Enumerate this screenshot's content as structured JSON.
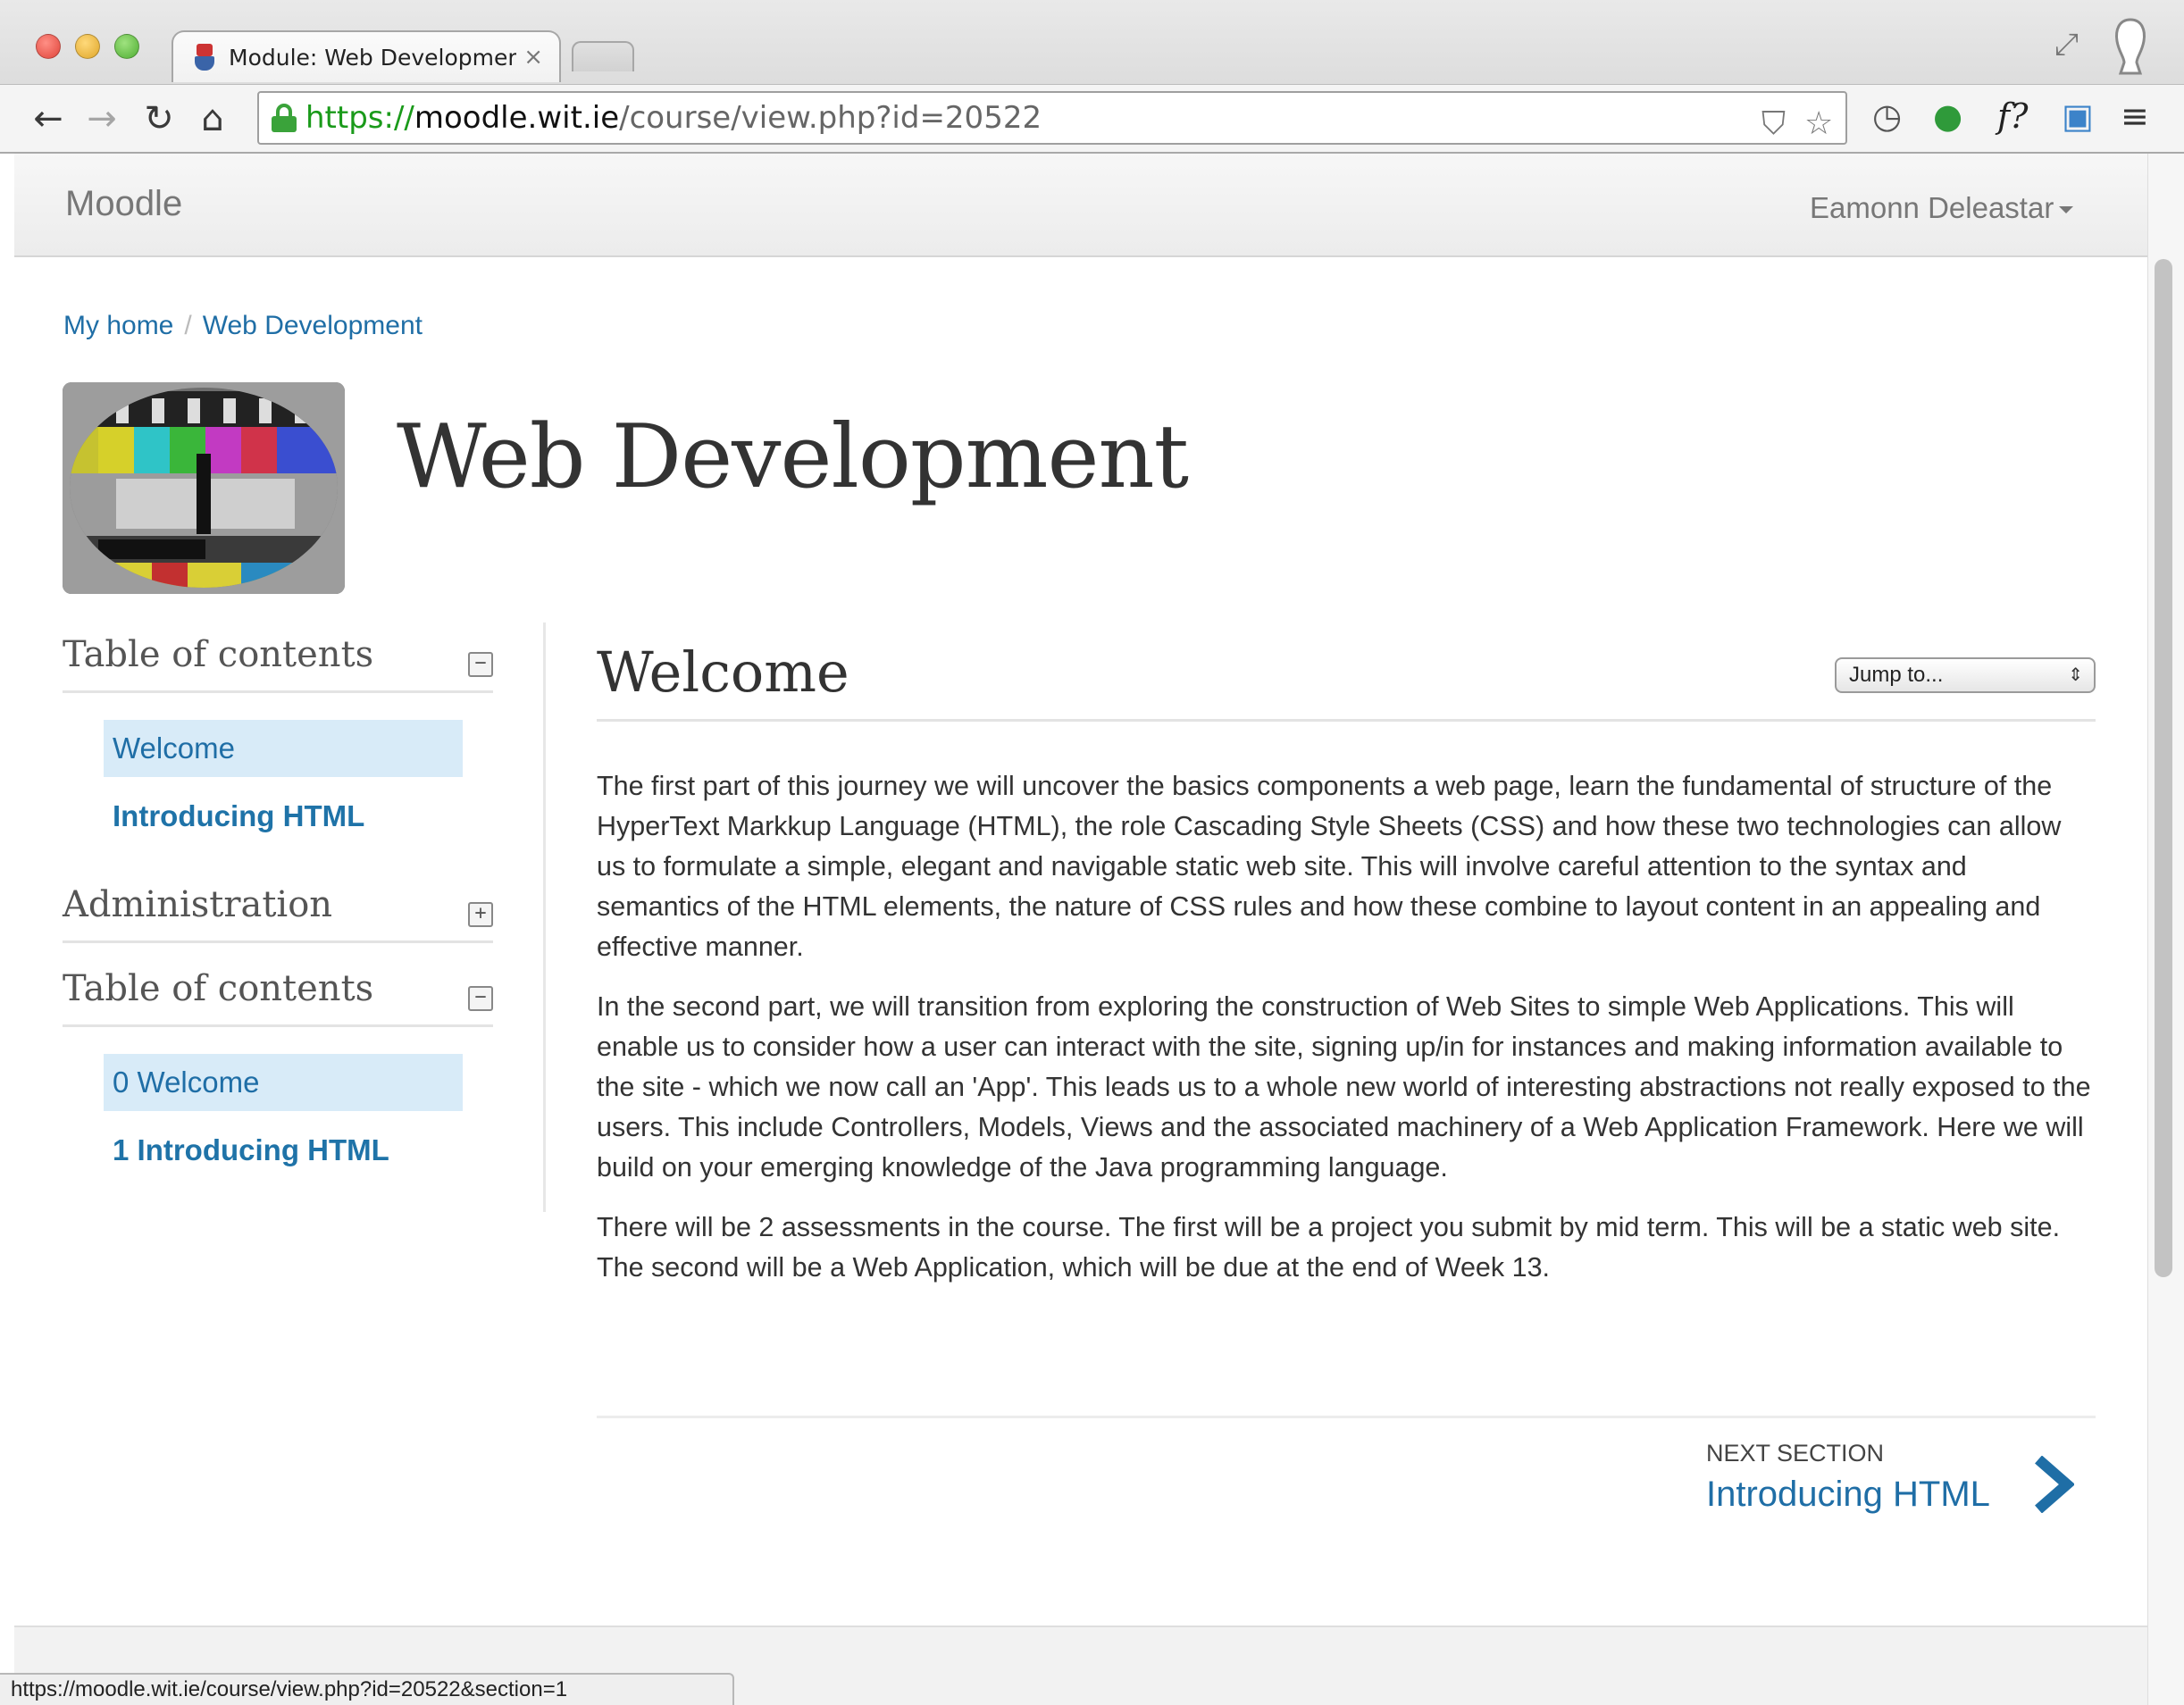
{
  "browser": {
    "tab_title": "Module: Web Development",
    "tab_close": "×",
    "url_scheme": "https://",
    "url_host": "moodle.wit.ie",
    "url_path": "/course/view.php?id=20522",
    "status_url": "https://moodle.wit.ie/course/view.php?id=20522&section=1",
    "extension_f": "f?"
  },
  "navbar": {
    "brand": "Moodle",
    "user": "Eamonn Deleastar"
  },
  "breadcrumb": {
    "home": "My home",
    "sep": "/",
    "course": "Web Development"
  },
  "course": {
    "title": "Web Development"
  },
  "sidebar": {
    "blocks": [
      {
        "title": "Table of contents",
        "toggle": "−"
      },
      {
        "title": "Administration",
        "toggle": "+"
      },
      {
        "title": "Table of contents",
        "toggle": "−"
      }
    ],
    "toc1": [
      "Welcome",
      "Introducing HTML"
    ],
    "toc2": [
      "0 Welcome",
      "1 Introducing HTML"
    ]
  },
  "section": {
    "title": "Welcome",
    "jump_label": "Jump to...",
    "jump_arrows": "⇕",
    "paragraphs": [
      "The first part of this journey we will uncover the basics components a web page, learn the fundamental of structure of the HyperText Markkup Language (HTML), the role Cascading Style Sheets (CSS) and how these two technologies can allow us to formulate a simple, elegant and navigable static web site. This will involve careful attention to the syntax and semantics of the HTML elements, the nature of CSS rules and how these combine to layout content in an appealing and effective manner.",
      "In the second part, we will transition from exploring the construction of Web Sites to simple Web Applications. This will enable us to consider how a user can interact with the site, signing up/in for instances and making information available to the site - which we now call an 'App'. This leads us to a whole new world of interesting abstractions not really exposed to the users. This include Controllers, Models, Views and the associated machinery of a Web Application Framework. Here we will build on your emerging knowledge of the Java programming language.",
      "There will be 2 assessments in the course. The first will be a project you submit by mid term. This will be a static web site. The second will be a Web Application, which will be due at the end of Week 13."
    ],
    "next_label": "NEXT SECTION",
    "next_link": "Introducing HTML"
  },
  "colors": {
    "link": "#1f6ea6",
    "toc_active_bg": "#d8ebf8",
    "secure_green": "#3aa33a"
  }
}
